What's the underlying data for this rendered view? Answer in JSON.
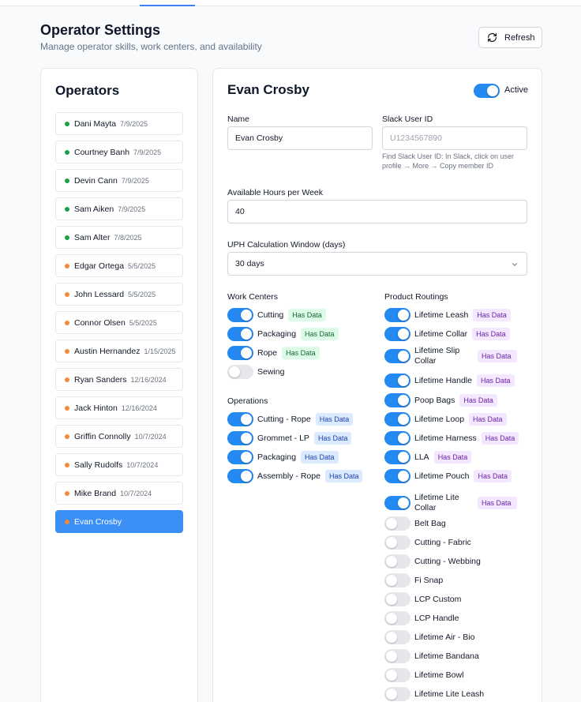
{
  "page": {
    "title": "Operator Settings",
    "subtitle": "Manage operator skills, work centers, and availability",
    "refresh_label": "Refresh"
  },
  "operators_title": "Operators",
  "operators": [
    {
      "name": "Dani Mayta",
      "date": "7/9/2025",
      "status": "green"
    },
    {
      "name": "Courtney Banh",
      "date": "7/9/2025",
      "status": "green"
    },
    {
      "name": "Devin Cann",
      "date": "7/9/2025",
      "status": "green"
    },
    {
      "name": "Sam Aiken",
      "date": "7/9/2025",
      "status": "green"
    },
    {
      "name": "Sam Alter",
      "date": "7/8/2025",
      "status": "green"
    },
    {
      "name": "Edgar Ortega",
      "date": "5/5/2025",
      "status": "orange"
    },
    {
      "name": "John Lessard",
      "date": "5/5/2025",
      "status": "orange"
    },
    {
      "name": "Connor Olsen",
      "date": "5/5/2025",
      "status": "orange"
    },
    {
      "name": "Austin Hernandez",
      "date": "1/15/2025",
      "status": "orange"
    },
    {
      "name": "Ryan Sanders",
      "date": "12/16/2024",
      "status": "orange"
    },
    {
      "name": "Jack Hinton",
      "date": "12/16/2024",
      "status": "orange"
    },
    {
      "name": "Griffin Connolly",
      "date": "10/7/2024",
      "status": "orange"
    },
    {
      "name": "Sally Rudolfs",
      "date": "10/7/2024",
      "status": "orange"
    },
    {
      "name": "Mike Brand",
      "date": "10/7/2024",
      "status": "orange"
    },
    {
      "name": "Evan Crosby",
      "date": "",
      "status": "orange",
      "selected": true
    }
  ],
  "status_colors": {
    "green": "#16a34a",
    "orange": "#f28a3c"
  },
  "detail": {
    "name": "Evan Crosby",
    "active_label": "Active",
    "active": true,
    "name_label": "Name",
    "name_value": "Evan Crosby",
    "slack_label": "Slack User ID",
    "slack_placeholder": "U1234567890",
    "slack_help": "Find Slack User ID: In Slack, click on user profile → More → Copy member ID",
    "hours_label": "Available Hours per Week",
    "hours_value": "40",
    "uph_label": "UPH Calculation Window (days)",
    "uph_value": "30 days"
  },
  "work_centers_label": "Work Centers",
  "work_centers": [
    {
      "label": "Cutting",
      "on": true,
      "badge": "Has Data"
    },
    {
      "label": "Packaging",
      "on": true,
      "badge": "Has Data"
    },
    {
      "label": "Rope",
      "on": true,
      "badge": "Has Data"
    },
    {
      "label": "Sewing",
      "on": false,
      "badge": ""
    }
  ],
  "operations_label": "Operations",
  "operations": [
    {
      "label": "Cutting - Rope",
      "on": true,
      "badge": "Has Data"
    },
    {
      "label": "Grommet - LP",
      "on": true,
      "badge": "Has Data"
    },
    {
      "label": "Packaging",
      "on": true,
      "badge": "Has Data"
    },
    {
      "label": "Assembly - Rope",
      "on": true,
      "badge": "Has Data"
    }
  ],
  "routings_label": "Product Routings",
  "routings": [
    {
      "label": "Lifetime Leash",
      "on": true,
      "badge": "Has Data"
    },
    {
      "label": "Lifetime Collar",
      "on": true,
      "badge": "Has Data"
    },
    {
      "label": "Lifetime Slip Collar",
      "on": true,
      "badge": "Has Data"
    },
    {
      "label": "Lifetime Handle",
      "on": true,
      "badge": "Has Data"
    },
    {
      "label": "Poop Bags",
      "on": true,
      "badge": "Has Data"
    },
    {
      "label": "Lifetime Loop",
      "on": true,
      "badge": "Has Data"
    },
    {
      "label": "Lifetime Harness",
      "on": true,
      "badge": "Has Data"
    },
    {
      "label": "LLA",
      "on": true,
      "badge": "Has Data"
    },
    {
      "label": "Lifetime Pouch",
      "on": true,
      "badge": "Has Data"
    },
    {
      "label": "Lifetime Lite Collar",
      "on": true,
      "badge": "Has Data"
    },
    {
      "label": "Belt Bag",
      "on": false,
      "badge": ""
    },
    {
      "label": "Cutting - Fabric",
      "on": false,
      "badge": ""
    },
    {
      "label": "Cutting - Webbing",
      "on": false,
      "badge": ""
    },
    {
      "label": "Fi Snap",
      "on": false,
      "badge": ""
    },
    {
      "label": "LCP Custom",
      "on": false,
      "badge": ""
    },
    {
      "label": "LCP Handle",
      "on": false,
      "badge": ""
    },
    {
      "label": "Lifetime Air - Bio",
      "on": false,
      "badge": ""
    },
    {
      "label": "Lifetime Bandana",
      "on": false,
      "badge": ""
    },
    {
      "label": "Lifetime Bowl",
      "on": false,
      "badge": ""
    },
    {
      "label": "Lifetime Lite Leash",
      "on": false,
      "badge": ""
    }
  ]
}
